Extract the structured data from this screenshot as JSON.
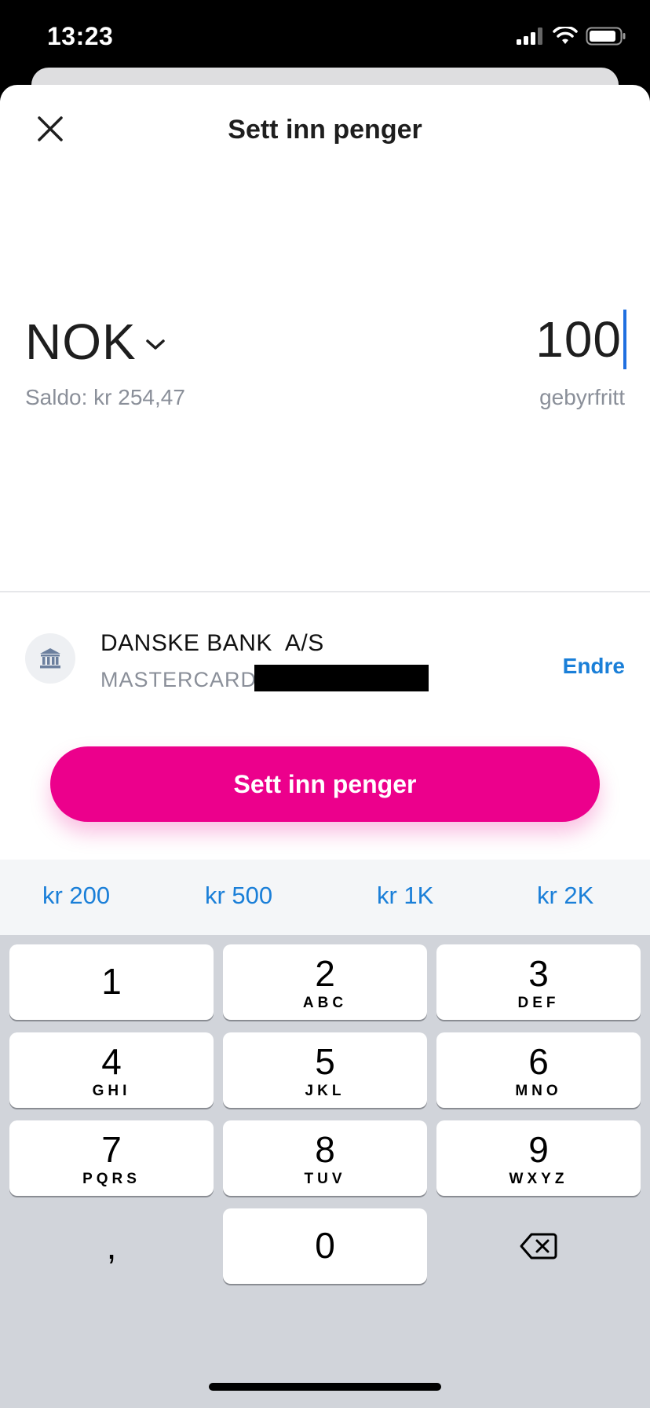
{
  "status_bar": {
    "time": "13:23"
  },
  "header": {
    "title": "Sett inn penger",
    "close_icon": "close-icon"
  },
  "amount": {
    "currency": "NOK",
    "balance": "Saldo: kr 254,47",
    "value": "100",
    "fee_note": "gebyrfritt"
  },
  "payment_method": {
    "bank_name": "DANSKE BANK  A/S",
    "card_type": "MASTERCARD",
    "change_label": "Endre",
    "icon": "bank-icon"
  },
  "deposit_button": {
    "label": "Sett inn penger",
    "color": "#ec008c"
  },
  "quick_amounts": [
    "kr 200",
    "kr 500",
    "kr 1K",
    "kr 2K"
  ],
  "keypad": {
    "keys": [
      {
        "num": "1",
        "letters": ""
      },
      {
        "num": "2",
        "letters": "ABC"
      },
      {
        "num": "3",
        "letters": "DEF"
      },
      {
        "num": "4",
        "letters": "GHI"
      },
      {
        "num": "5",
        "letters": "JKL"
      },
      {
        "num": "6",
        "letters": "MNO"
      },
      {
        "num": "7",
        "letters": "PQRS"
      },
      {
        "num": "8",
        "letters": "TUV"
      },
      {
        "num": "9",
        "letters": "WXYZ"
      },
      {
        "num": "0",
        "letters": ""
      }
    ],
    "comma": ",",
    "delete_icon": "backspace-icon"
  },
  "colors": {
    "accent": "#1a7fd8",
    "brand": "#ec008c"
  }
}
